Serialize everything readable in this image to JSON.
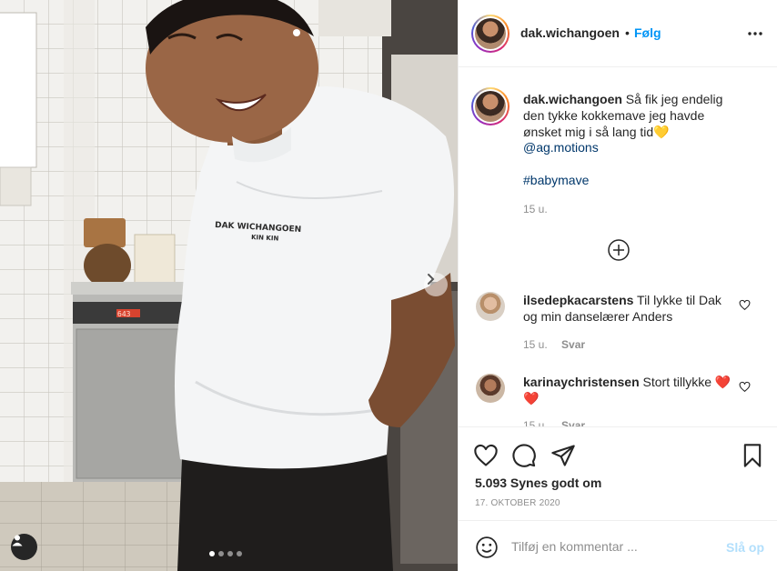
{
  "post": {
    "username": "dak.wichangoen",
    "separator": "•",
    "follow_label": "Følg",
    "more_icon": "more-horizontal-icon"
  },
  "photo": {
    "shirt_text_line1": "DAK WICHANGOEN",
    "shirt_text_line2": "KIN KIN",
    "oven_display": "643",
    "carousel_dots": 4,
    "active_dot": 0
  },
  "caption": {
    "username": "dak.wichangoen",
    "text": " Så fik jeg endelig den tykke kokkemave jeg havde ønsket mig i så lang tid💛",
    "mention": "@ag.motions",
    "hashtag": "#babymave",
    "time": "15 u."
  },
  "comments": [
    {
      "username": "ilsedepkacarstens",
      "text": " Til lykke til Dak og min danselærer Anders",
      "time": "15 u.",
      "reply": "Svar"
    },
    {
      "username": "karinaychristensen",
      "text": " Stort tillykke ❤️❤️",
      "time": "15 u.",
      "reply": "Svar"
    }
  ],
  "actions": {
    "likes": "5.093 Synes godt om",
    "date": "17. OKTOBER 2020"
  },
  "composer": {
    "placeholder": "Tilføj en kommentar ...",
    "post_label": "Slå op"
  },
  "colors": {
    "accent": "#0095f6",
    "post_disabled": "#b2dffc",
    "muted": "#8e8e8e",
    "text": "#262626",
    "link": "#00376b"
  }
}
